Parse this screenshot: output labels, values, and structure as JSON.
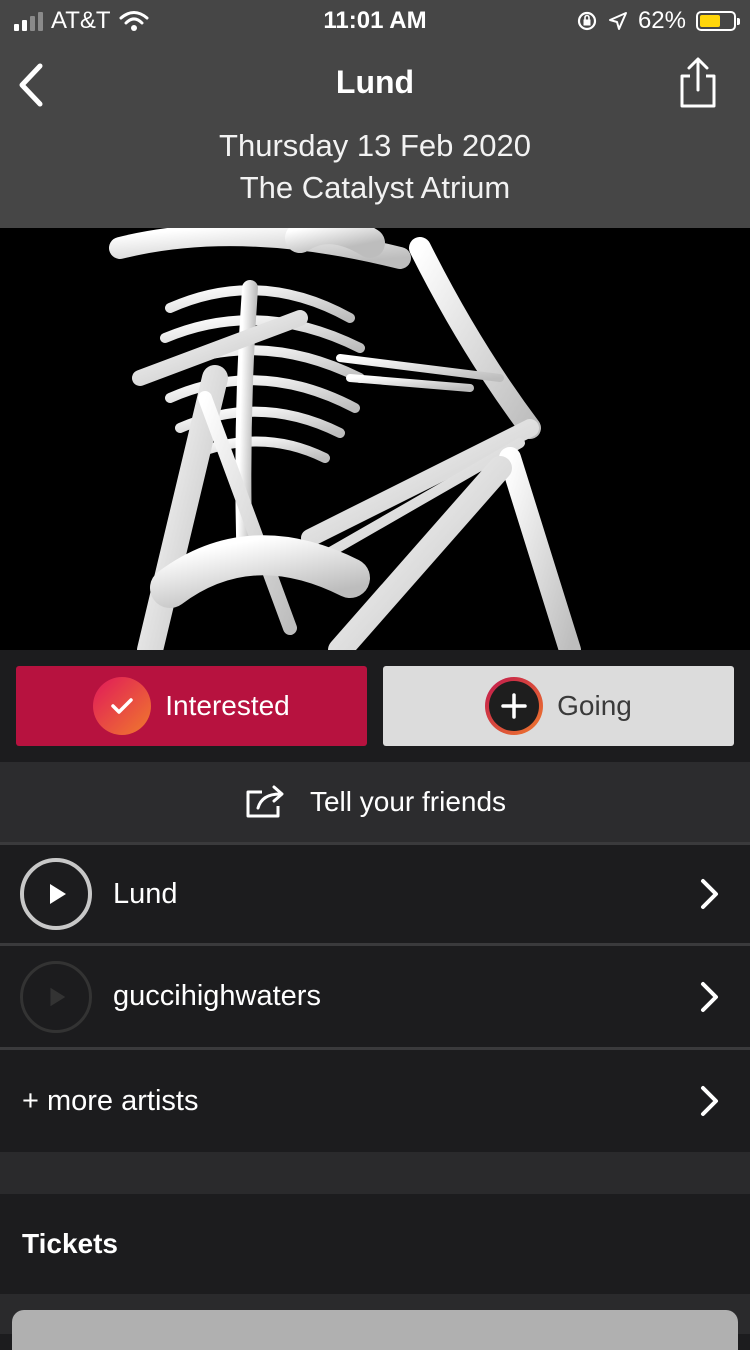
{
  "status_bar": {
    "carrier": "AT&T",
    "time": "11:01 AM",
    "battery_percent": "62%",
    "battery_level": 0.62,
    "icons": [
      "signal-icon",
      "wifi-icon",
      "orientation-lock-icon",
      "location-icon",
      "battery-icon"
    ]
  },
  "nav": {
    "title": "Lund",
    "back_icon": "chevron-left-icon",
    "share_icon": "share-icon"
  },
  "event": {
    "date": "Thursday 13 Feb 2020",
    "venue": "The Catalyst Atrium"
  },
  "hero_image": {
    "description_icon": "skeleton-artwork"
  },
  "actions": {
    "interested_label": "Interested",
    "going_label": "Going",
    "interested_color": "#b7123f",
    "going_color": "#dcdcdc"
  },
  "tell_friends": {
    "label": "Tell your friends",
    "icon": "share-out-icon"
  },
  "artists": [
    {
      "name": "Lund",
      "playable": true
    },
    {
      "name": "guccihighwaters",
      "playable": false
    }
  ],
  "more_artists": {
    "label": "+ more artists"
  },
  "tickets": {
    "title": "Tickets"
  }
}
